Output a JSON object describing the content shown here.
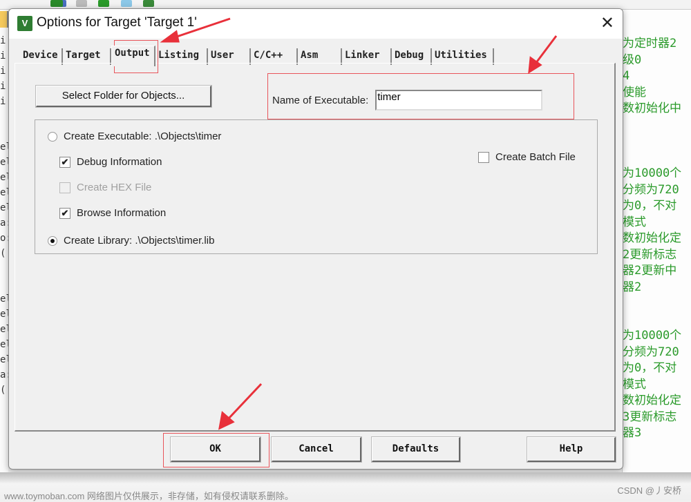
{
  "dialog": {
    "title": "Options for Target 'Target 1'",
    "app_icon": "keil-uvision-icon",
    "close_label": "✕",
    "tabs": [
      {
        "label": "Device"
      },
      {
        "label": "Target"
      },
      {
        "label": "Output",
        "active": true
      },
      {
        "label": "Listing"
      },
      {
        "label": "User"
      },
      {
        "label": "C/C++"
      },
      {
        "label": "Asm"
      },
      {
        "label": "Linker"
      },
      {
        "label": "Debug"
      },
      {
        "label": "Utilities"
      }
    ],
    "output": {
      "select_folder_label": "Select Folder for Objects...",
      "name_label": "Name of Executable:",
      "name_value": "timer",
      "create_executable_label": "Create Executable:  .\\Objects\\timer",
      "create_executable_selected": false,
      "debug_info_label": "Debug Information",
      "debug_info_checked": true,
      "create_hex_label": "Create HEX File",
      "create_hex_checked": false,
      "browse_info_label": "Browse Information",
      "browse_info_checked": true,
      "create_library_label": "Create Library:  .\\Objects\\timer.lib",
      "create_library_selected": true,
      "batch_label": "Create Batch File",
      "batch_checked": false
    },
    "buttons": {
      "ok": "OK",
      "cancel": "Cancel",
      "defaults": "Defaults",
      "help": "Help"
    }
  },
  "background": {
    "left_code": [
      "i",
      "i",
      "i",
      "i",
      "i",
      "",
      "",
      "el",
      "el",
      "el",
      "el",
      "el",
      "a:",
      "o:",
      "(",
      "",
      "",
      "el",
      "el",
      "el",
      "el",
      "el",
      "a:",
      "("
    ],
    "right_code": [
      "为定时器2",
      "级0",
      "4",
      "使能",
      "数初始化中",
      "",
      "",
      "",
      "为10000个",
      "分频为720",
      "为0，不对",
      "模式",
      "数初始化定",
      "2更新标志",
      "器2更新中",
      "器2",
      "",
      "",
      "为10000个",
      "分频为720",
      "为0，不对",
      "模式",
      "数初始化定",
      "3更新标志",
      "器3"
    ]
  },
  "watermark": "www.toymoban.com 网络图片仅供展示，非存储，如有侵权请联系删除。",
  "credit": "CSDN @丿安桥",
  "colors": {
    "annotation_red": "#e8545a",
    "code_green": "#2a9a2a"
  }
}
